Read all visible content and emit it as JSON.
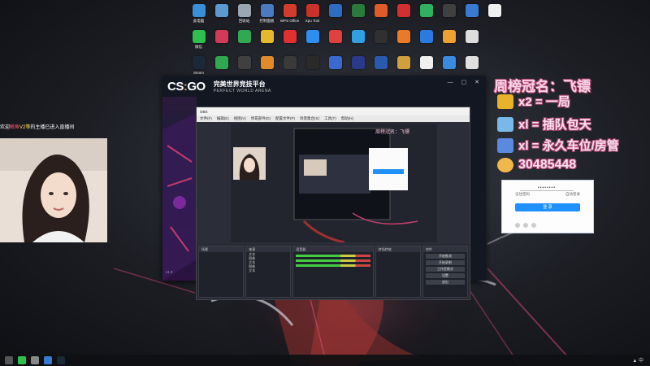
{
  "desktop": {
    "icons_row1": [
      {
        "label": "此电脑",
        "color": "#3a8fd8"
      },
      {
        "label": "",
        "color": "#5a9ad0"
      },
      {
        "label": "回收站",
        "color": "#9aa6b2"
      },
      {
        "label": "控制面板",
        "color": "#4a7ac0"
      },
      {
        "label": "WPS Office",
        "color": "#d23c2c"
      },
      {
        "label": "Xpu Tool",
        "color": "#c8322a"
      },
      {
        "label": "",
        "color": "#2e6cc2"
      },
      {
        "label": "",
        "color": "#2a7a3e"
      },
      {
        "label": "",
        "color": "#e05a2a"
      },
      {
        "label": "",
        "color": "#d03030"
      },
      {
        "label": "",
        "color": "#30b060"
      },
      {
        "label": "",
        "color": "#404040"
      },
      {
        "label": "",
        "color": "#3a7ad0"
      },
      {
        "label": "",
        "color": "#f0f0f0"
      }
    ],
    "icons_row2": [
      {
        "label": "微信",
        "color": "#2fbf4f"
      },
      {
        "label": "",
        "color": "#d23a5a"
      },
      {
        "label": "",
        "color": "#32a852"
      },
      {
        "label": "",
        "color": "#e6b82c"
      },
      {
        "label": "",
        "color": "#e03030"
      },
      {
        "label": "",
        "color": "#2d8ef0"
      },
      {
        "label": "",
        "color": "#e04040"
      },
      {
        "label": "",
        "color": "#30a0e0"
      },
      {
        "label": "",
        "color": "#303030"
      },
      {
        "label": "",
        "color": "#e87a2a"
      },
      {
        "label": "",
        "color": "#2a7ae0"
      },
      {
        "label": "",
        "color": "#f0a030"
      },
      {
        "label": "",
        "color": "#dddddd"
      }
    ],
    "icons_row3": [
      {
        "label": "Steam",
        "color": "#1b2838"
      },
      {
        "label": "",
        "color": "#2fa84f"
      },
      {
        "label": "",
        "color": "#404040"
      },
      {
        "label": "",
        "color": "#e08a2a"
      },
      {
        "label": "",
        "color": "#3a3a3a"
      },
      {
        "label": "",
        "color": "#2a2a2a"
      },
      {
        "label": "",
        "color": "#3a6ad0"
      },
      {
        "label": "",
        "color": "#2a3a8a"
      },
      {
        "label": "",
        "color": "#2a5ab0"
      },
      {
        "label": "",
        "color": "#d0a040"
      },
      {
        "label": "",
        "color": "#f0f0f0"
      },
      {
        "label": "",
        "color": "#3a8ae0"
      },
      {
        "label": "",
        "color": "#e0e0e0"
      }
    ]
  },
  "csgo": {
    "logo_cs": "CS",
    "logo_go": "GO",
    "pw_cn": "完美世界竞技平台",
    "pw_en": "PERFECT WORLD ARENA",
    "version": "v1.0"
  },
  "obs": {
    "title": "OBS",
    "menu": [
      "文件(F)",
      "编辑(E)",
      "视图(V)",
      "停靠部件(D)",
      "配置文件(P)",
      "场景集合(S)",
      "工具(T)",
      "帮助(H)"
    ],
    "docks": {
      "scenes": "场景",
      "sources": "来源",
      "mixer": "混音器",
      "transitions": "转场特效",
      "controls": "控件"
    },
    "source_items": [
      "文本",
      "图像",
      "文本",
      "图像",
      "文本"
    ],
    "controls_buttons": [
      "开始推流",
      "开始录制",
      "工作室模式",
      "设置",
      "退出"
    ]
  },
  "stream_overlay": {
    "ticker_prefix": "欢迎",
    "ticker_highlight": "鲸鱼",
    "ticker_mid": "V2等",
    "ticker_suffix": "的主播已进入直播间",
    "crown_title": "周榜冠名：飞镖",
    "gift_rows": [
      {
        "text": "x2 = 一局",
        "color": "#e6b32a"
      },
      {
        "text": "xl = 插队包天",
        "color": "#7ab8e8"
      },
      {
        "text": "xl = 永久车位/房管",
        "color": "#5a8ae0"
      }
    ],
    "qq": "30485448",
    "login": {
      "password_mask": "••••••••",
      "remember": "记住密码",
      "auto_login": "自动登录",
      "login_button": "登 录"
    }
  },
  "taskbar": {
    "tray_text": "▲ 中"
  }
}
